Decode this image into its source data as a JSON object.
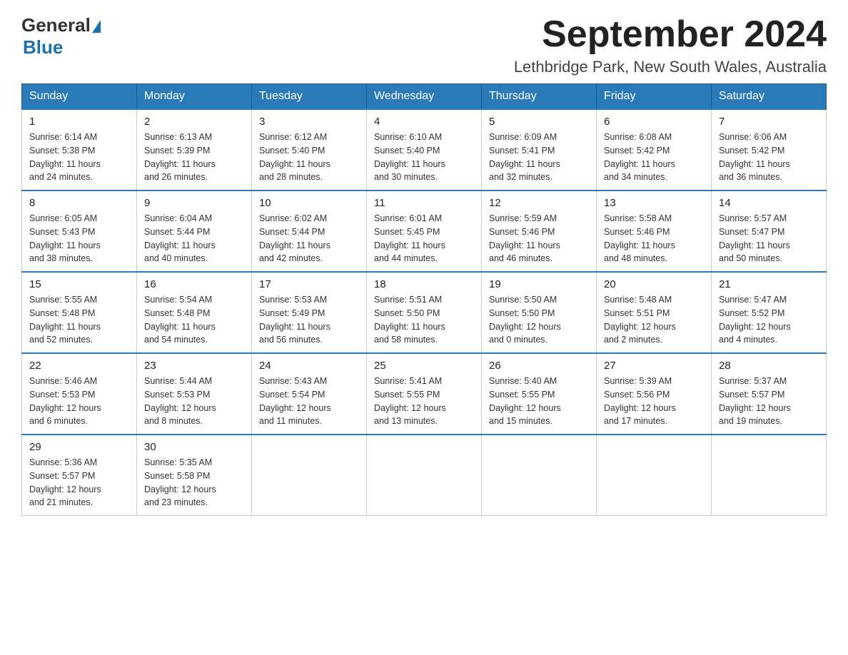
{
  "header": {
    "logo_general": "General",
    "logo_blue": "Blue",
    "month_title": "September 2024",
    "location": "Lethbridge Park, New South Wales, Australia"
  },
  "days_of_week": [
    "Sunday",
    "Monday",
    "Tuesday",
    "Wednesday",
    "Thursday",
    "Friday",
    "Saturday"
  ],
  "weeks": [
    [
      {
        "day": "1",
        "sunrise": "6:14 AM",
        "sunset": "5:38 PM",
        "daylight": "11 hours and 24 minutes."
      },
      {
        "day": "2",
        "sunrise": "6:13 AM",
        "sunset": "5:39 PM",
        "daylight": "11 hours and 26 minutes."
      },
      {
        "day": "3",
        "sunrise": "6:12 AM",
        "sunset": "5:40 PM",
        "daylight": "11 hours and 28 minutes."
      },
      {
        "day": "4",
        "sunrise": "6:10 AM",
        "sunset": "5:40 PM",
        "daylight": "11 hours and 30 minutes."
      },
      {
        "day": "5",
        "sunrise": "6:09 AM",
        "sunset": "5:41 PM",
        "daylight": "11 hours and 32 minutes."
      },
      {
        "day": "6",
        "sunrise": "6:08 AM",
        "sunset": "5:42 PM",
        "daylight": "11 hours and 34 minutes."
      },
      {
        "day": "7",
        "sunrise": "6:06 AM",
        "sunset": "5:42 PM",
        "daylight": "11 hours and 36 minutes."
      }
    ],
    [
      {
        "day": "8",
        "sunrise": "6:05 AM",
        "sunset": "5:43 PM",
        "daylight": "11 hours and 38 minutes."
      },
      {
        "day": "9",
        "sunrise": "6:04 AM",
        "sunset": "5:44 PM",
        "daylight": "11 hours and 40 minutes."
      },
      {
        "day": "10",
        "sunrise": "6:02 AM",
        "sunset": "5:44 PM",
        "daylight": "11 hours and 42 minutes."
      },
      {
        "day": "11",
        "sunrise": "6:01 AM",
        "sunset": "5:45 PM",
        "daylight": "11 hours and 44 minutes."
      },
      {
        "day": "12",
        "sunrise": "5:59 AM",
        "sunset": "5:46 PM",
        "daylight": "11 hours and 46 minutes."
      },
      {
        "day": "13",
        "sunrise": "5:58 AM",
        "sunset": "5:46 PM",
        "daylight": "11 hours and 48 minutes."
      },
      {
        "day": "14",
        "sunrise": "5:57 AM",
        "sunset": "5:47 PM",
        "daylight": "11 hours and 50 minutes."
      }
    ],
    [
      {
        "day": "15",
        "sunrise": "5:55 AM",
        "sunset": "5:48 PM",
        "daylight": "11 hours and 52 minutes."
      },
      {
        "day": "16",
        "sunrise": "5:54 AM",
        "sunset": "5:48 PM",
        "daylight": "11 hours and 54 minutes."
      },
      {
        "day": "17",
        "sunrise": "5:53 AM",
        "sunset": "5:49 PM",
        "daylight": "11 hours and 56 minutes."
      },
      {
        "day": "18",
        "sunrise": "5:51 AM",
        "sunset": "5:50 PM",
        "daylight": "11 hours and 58 minutes."
      },
      {
        "day": "19",
        "sunrise": "5:50 AM",
        "sunset": "5:50 PM",
        "daylight": "12 hours and 0 minutes."
      },
      {
        "day": "20",
        "sunrise": "5:48 AM",
        "sunset": "5:51 PM",
        "daylight": "12 hours and 2 minutes."
      },
      {
        "day": "21",
        "sunrise": "5:47 AM",
        "sunset": "5:52 PM",
        "daylight": "12 hours and 4 minutes."
      }
    ],
    [
      {
        "day": "22",
        "sunrise": "5:46 AM",
        "sunset": "5:53 PM",
        "daylight": "12 hours and 6 minutes."
      },
      {
        "day": "23",
        "sunrise": "5:44 AM",
        "sunset": "5:53 PM",
        "daylight": "12 hours and 8 minutes."
      },
      {
        "day": "24",
        "sunrise": "5:43 AM",
        "sunset": "5:54 PM",
        "daylight": "12 hours and 11 minutes."
      },
      {
        "day": "25",
        "sunrise": "5:41 AM",
        "sunset": "5:55 PM",
        "daylight": "12 hours and 13 minutes."
      },
      {
        "day": "26",
        "sunrise": "5:40 AM",
        "sunset": "5:55 PM",
        "daylight": "12 hours and 15 minutes."
      },
      {
        "day": "27",
        "sunrise": "5:39 AM",
        "sunset": "5:56 PM",
        "daylight": "12 hours and 17 minutes."
      },
      {
        "day": "28",
        "sunrise": "5:37 AM",
        "sunset": "5:57 PM",
        "daylight": "12 hours and 19 minutes."
      }
    ],
    [
      {
        "day": "29",
        "sunrise": "5:36 AM",
        "sunset": "5:57 PM",
        "daylight": "12 hours and 21 minutes."
      },
      {
        "day": "30",
        "sunrise": "5:35 AM",
        "sunset": "5:58 PM",
        "daylight": "12 hours and 23 minutes."
      },
      null,
      null,
      null,
      null,
      null
    ]
  ],
  "labels": {
    "sunrise": "Sunrise:",
    "sunset": "Sunset:",
    "daylight": "Daylight:"
  }
}
